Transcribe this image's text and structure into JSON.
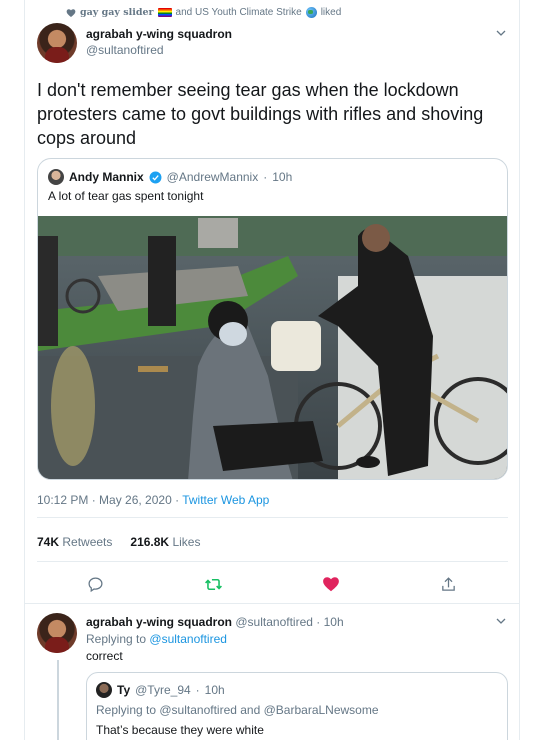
{
  "social_context": {
    "text_prefix": "gay gay slider",
    "text_suffix": "and US Youth Climate Strike",
    "action": "liked"
  },
  "tweet": {
    "author_name": "agrabah y-wing squadron",
    "author_handle": "@sultanoftired",
    "text": "I don't remember seeing tear gas when the lockdown protesters came to govt buildings with rifles and shoving cops around",
    "quoted": {
      "author_name": "Andy Mannix",
      "author_handle": "@AndrewMannix",
      "time": "10h",
      "text": "A lot of tear gas spent tonight"
    },
    "timestamp": "10:12 PM · May 26, 2020",
    "via_separator": " · ",
    "app": "Twitter Web App",
    "retweets_count": "74K",
    "retweets_label": "Retweets",
    "likes_count": "216.8K",
    "likes_label": "Likes",
    "liked": true
  },
  "reply": {
    "author_name": "agrabah y-wing squadron",
    "author_handle": "@sultanoftired",
    "time": "10h",
    "replying_prefix": "Replying to",
    "replying_to": "@sultanoftired",
    "text": "correct",
    "nested": {
      "author_name": "Ty",
      "author_handle": "@Tyre_94",
      "time": "10h",
      "replying_text": "Replying to @sultanoftired and @BarbaraLNewsome",
      "text": "That’s because they were white"
    }
  },
  "colors": {
    "accent": "#1b95e0",
    "like": "#e0245e",
    "retweet": "#17bf63",
    "muted": "#657786",
    "border": "#e6ecf0"
  },
  "icons": [
    "heart-icon",
    "rainbow-flag-icon",
    "globe-icon",
    "chevron-down-icon",
    "verified-icon",
    "reply-icon",
    "retweet-icon",
    "like-icon",
    "share-icon"
  ]
}
